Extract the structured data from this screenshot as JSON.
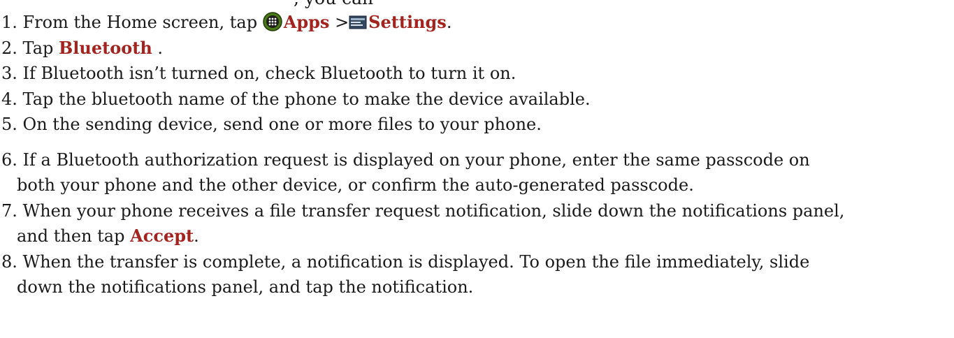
{
  "header_fragment": ", you can",
  "steps": [
    {
      "num": "1.",
      "pre": "From the Home screen, tap",
      "apps_icon": "apps-icon",
      "apps": "Apps",
      "sep": ">",
      "settings_icon": "settings-icon",
      "settings": "Settings",
      "end": "."
    },
    {
      "num": "2.",
      "pre": "Tap",
      "em": "Bluetooth",
      "end": "."
    },
    {
      "num": "3.",
      "text": "If Bluetooth isn’t turned on, check Bluetooth to turn it on."
    },
    {
      "num": "4.",
      "text": "Tap the bluetooth name of the phone to make the device available."
    },
    {
      "num": "5.",
      "text": "On the sending device, send one or more files to your phone."
    },
    {
      "num": "6.",
      "line1": "If a Bluetooth authorization request is displayed on your phone, enter the same passcode on",
      "line2": "both your phone and the other device, or confirm the auto-generated passcode."
    },
    {
      "num": "7.",
      "line1": "When your phone receives a file transfer request notification, slide down the notifications panel,",
      "line2_pre": "and then tap",
      "em": "Accept",
      "end": "."
    },
    {
      "num": "8.",
      "line1": "When the transfer is complete, a notification is displayed. To open the file immediately, slide",
      "line2": "down the notifications panel, and tap the notification."
    }
  ],
  "colors": {
    "emphasis": "#a3231f",
    "text": "#1a1a1a",
    "apps_icon_fill": "#4a7a16",
    "settings_icon_fill": "#33475e"
  }
}
